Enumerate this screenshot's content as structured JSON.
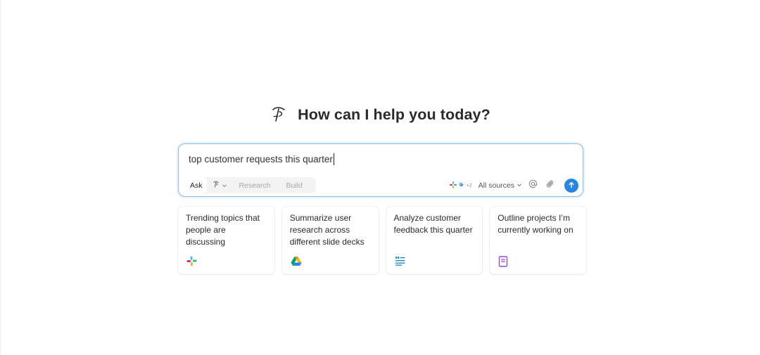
{
  "heading": {
    "title": "How can I help you today?",
    "logo_icon": "brand-logo-icon"
  },
  "composer": {
    "query": "top customer requests this quarter",
    "modes": {
      "ask": "Ask",
      "research": "Research",
      "build": "Build"
    },
    "sources": {
      "plus_count": "+2",
      "label": "All sources"
    },
    "accent_color": "#2a85e0",
    "border_color": "#8ec0ec"
  },
  "suggestions": [
    {
      "text": "Trending topics that people are discussing",
      "icon": "slack-icon"
    },
    {
      "text": "Summarize user research across different slide decks",
      "icon": "google-drive-icon"
    },
    {
      "text": "Analyze customer feedback this quarter",
      "icon": "quote-doc-icon"
    },
    {
      "text": "Outline projects I’m currently working on",
      "icon": "notebook-icon"
    }
  ]
}
